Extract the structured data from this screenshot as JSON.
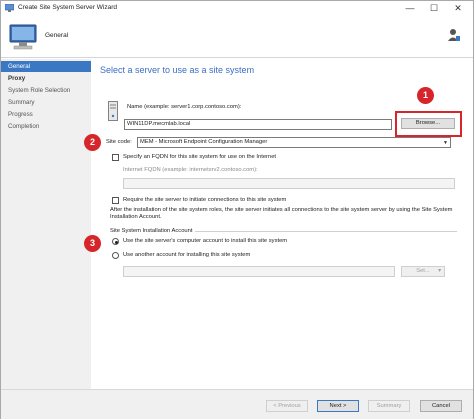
{
  "window": {
    "title": "Create Site System Server Wizard",
    "controls": [
      "—",
      "☐",
      "✕"
    ]
  },
  "header": {
    "title": "General"
  },
  "nav": {
    "items": [
      {
        "label": "General"
      },
      {
        "label": "Proxy"
      },
      {
        "label": "System Role Selection"
      },
      {
        "label": "Summary"
      },
      {
        "label": "Progress"
      },
      {
        "label": "Completion"
      }
    ]
  },
  "main": {
    "heading": "Select a server to use as a site system",
    "name_label": "Name (example: server1.corp.contoso.com):",
    "name_value": "WIN11DP.mecmlab.local",
    "browse_label": "Browse...",
    "site_code_label": "Site code:",
    "site_code_value": "MEM - Microsoft Endpoint Configuration Manager",
    "fqdn_checkbox_label": "Specify an FQDN for this site system for use on the Internet",
    "internet_fqdn_label": "Internet FQDN (example: internetsrv2.contoso.com):",
    "require_checkbox_label": "Require the site server to initiate connections to this site system",
    "info_text_line1": "After the  installation of the site system roles, the site server initiates all connections to the site system server by using the Site System",
    "info_text_line2": "Installation Account.",
    "install_account_group": "Site System Installation Account",
    "radio_computer_label": "Use the site server's computer account to install this site system",
    "radio_another_label": "Use another account for installing this site system",
    "set_label": "Set...",
    "set_arrow": "▾"
  },
  "callouts": [
    "1",
    "2",
    "3"
  ],
  "footer": {
    "previous": "< Previous",
    "next": "Next >",
    "summary": "Summary",
    "cancel": "Cancel"
  },
  "colors": {
    "accent": "#3a78c4",
    "callout": "#d6262b",
    "heading": "#3b6ec5"
  }
}
